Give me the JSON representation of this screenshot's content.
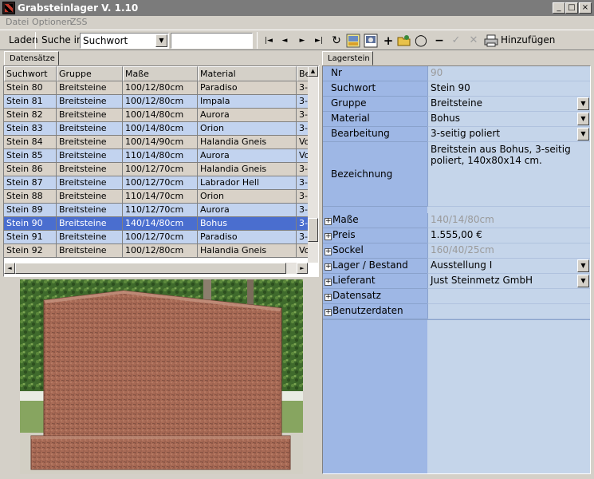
{
  "window": {
    "title": "Grabsteinlager V. 1.10",
    "min": "_",
    "max": "□",
    "close": "×"
  },
  "menu": [
    "Datei",
    "Optionen",
    "ZSS"
  ],
  "toolbar": {
    "load_label": "Laden",
    "search_in_label": "Suche in:",
    "search_field": "Suchwort",
    "search_value": "",
    "nav": [
      "|◄",
      "◄",
      "►",
      "►|"
    ],
    "add_label": "Hinzufügen"
  },
  "tabs": {
    "left": "Datensätze",
    "right": "Lagerstein"
  },
  "grid": {
    "columns": [
      "Suchwort",
      "Gruppe",
      "Maße",
      "Material",
      "Be"
    ],
    "rows": [
      [
        "Stein 80",
        "Breitsteine",
        "100/12/80cm",
        "Paradiso",
        "3-"
      ],
      [
        "Stein 81",
        "Breitsteine",
        "100/12/80cm",
        "Impala",
        "3-"
      ],
      [
        "Stein 82",
        "Breitsteine",
        "100/14/80cm",
        "Aurora",
        "3-"
      ],
      [
        "Stein 83",
        "Breitsteine",
        "100/14/80cm",
        "Orion",
        "3-"
      ],
      [
        "Stein 84",
        "Breitsteine",
        "100/14/90cm",
        "Halandia Gneis",
        "Vo"
      ],
      [
        "Stein 85",
        "Breitsteine",
        "110/14/80cm",
        "Aurora",
        "Vo"
      ],
      [
        "Stein 86",
        "Breitsteine",
        "100/12/70cm",
        "Halandia Gneis",
        "3-"
      ],
      [
        "Stein 87",
        "Breitsteine",
        "100/12/70cm",
        "Labrador Hell",
        "3-"
      ],
      [
        "Stein 88",
        "Breitsteine",
        "110/14/70cm",
        "Orion",
        "3-"
      ],
      [
        "Stein 89",
        "Breitsteine",
        "110/12/70cm",
        "Aurora",
        "3-"
      ],
      [
        "Stein 90",
        "Breitsteine",
        "140/14/80cm",
        "Bohus",
        "3-"
      ],
      [
        "Stein 91",
        "Breitsteine",
        "100/12/70cm",
        "Paradiso",
        "3-"
      ],
      [
        "Stein 92",
        "Breitsteine",
        "100/12/80cm",
        "Halandia Gneis",
        "Vo"
      ]
    ],
    "selected_index": 10,
    "scroll_left": "◄",
    "scroll_right": "►",
    "scroll_up": "▲"
  },
  "details": {
    "fields": [
      {
        "label": "Nr",
        "value": "90",
        "gray": true
      },
      {
        "label": "Suchwort",
        "value": "Stein 90"
      },
      {
        "label": "Gruppe",
        "value": "Breitsteine",
        "dropdown": true
      },
      {
        "label": "Material",
        "value": "Bohus",
        "dropdown": true
      },
      {
        "label": "Bearbeitung",
        "value": "3-seitig poliert",
        "dropdown": true
      }
    ],
    "bezeichnung_label": "Bezeichnung",
    "bezeichnung_line1": "Breitstein aus Bohus, 3-seitig",
    "bezeichnung_line2": "poliert, 140x80x14 cm.",
    "groups": [
      {
        "label": "Maße",
        "value": "140/14/80cm",
        "gray": true
      },
      {
        "label": "Preis",
        "value": "1.555,00 €"
      },
      {
        "label": "Sockel",
        "value": "160/40/25cm",
        "gray": true
      },
      {
        "label": "Lager / Bestand",
        "value": "Ausstellung I",
        "dropdown": true
      },
      {
        "label": "Lieferant",
        "value": "Just Steinmetz GmbH",
        "dropdown": true
      },
      {
        "label": "Datensatz",
        "value": ""
      },
      {
        "label": "Benutzerdaten",
        "value": ""
      }
    ]
  },
  "colors": {
    "row_odd": "#d9d2c8",
    "row_even": "#c2d3ef",
    "row_selected": "#4a6ecf",
    "label_bg": "#9eb7e5",
    "value_bg": "#c5d5ea"
  }
}
